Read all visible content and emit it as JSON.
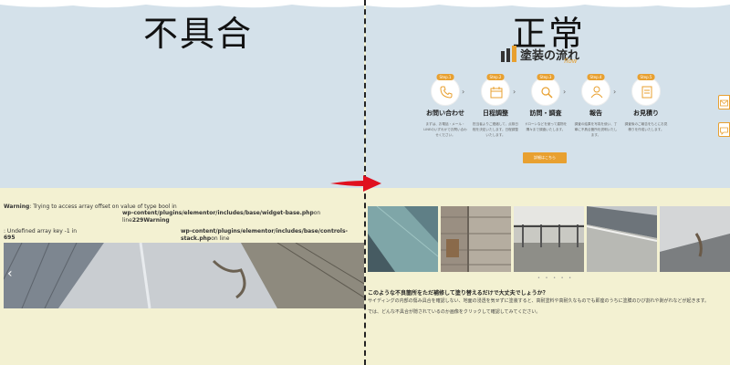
{
  "left": {
    "label": "不具合",
    "warnings": [
      {
        "strong": "Warning",
        "text": ": Trying to access array offset on value of type bool in"
      },
      {
        "strong": "",
        "text": "wp-content/plugins/elementor/includes/base/widget-base.php"
      },
      {
        "strong": "",
        "text": "on line"
      },
      {
        "strong": "229Warning",
        "text": ""
      },
      {
        "strong": "",
        "text": ": Undefined array key -1 in"
      },
      {
        "strong": "",
        "text": "wp-content/plugins/elementor/includes/base/controls-stack.php"
      },
      {
        "strong": "",
        "text": "on line"
      },
      {
        "strong": "695",
        "text": ""
      }
    ],
    "prev_arrow": "‹"
  },
  "right": {
    "label": "正常",
    "logo_text": "塗装の流れ",
    "logo_sub": "flow",
    "steps": [
      {
        "badge": "Step.1",
        "title": "お問い合わせ",
        "desc": "まずは、お電話・メール・LINEのいずれかでお問い合わせください。",
        "icon": "phone-icon"
      },
      {
        "badge": "Step.2",
        "title": "日程調整",
        "desc": "担当者よりご連絡して、点検日程を決定いたします。日程調整いたします。",
        "icon": "calendar-icon"
      },
      {
        "badge": "Step.3",
        "title": "訪問・調査",
        "desc": "ドローンなどを使って建物を隅々まで調査いたします。",
        "icon": "search-icon"
      },
      {
        "badge": "Step.4",
        "title": "報告",
        "desc": "調査の結果を写真を使い、丁寧に不具合箇所を説明いたします。",
        "icon": "person-icon"
      },
      {
        "badge": "Step.5",
        "title": "お見積り",
        "desc": "調査後のご報告をもとにお見積りを作成いたします。",
        "icon": "document-icon"
      }
    ],
    "cta_label": "詳細はこちら",
    "question_title": "このような不良箇所をただ補修して塗り替えるだけで大丈夫でしょうか？",
    "question_body_1": "サイディングの内部の傷み具合を確認しない、地面の浸透を気せずに塗装すると、高耐塗料や高耐久なものでも即座のうちに塗膜のひび割れや剥がれなどが起きます。",
    "question_body_2": "では、どんな不具合が隠されているのか画像をクリックして確認してみてください。",
    "dots": "• • • • •"
  },
  "colors": {
    "sky": "#d4e1ea",
    "cream": "#f3f1d2",
    "accent": "#e8a030",
    "arrow": "#e0101f"
  }
}
